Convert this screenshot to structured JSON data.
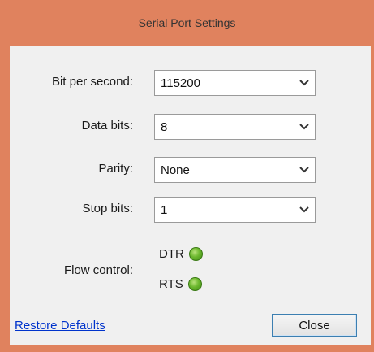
{
  "window": {
    "title": "Serial Port Settings"
  },
  "fields": [
    {
      "label": "Bit per second:",
      "value": "115200"
    },
    {
      "label": "Data bits:",
      "value": "8"
    },
    {
      "label": "Parity:",
      "value": "None"
    },
    {
      "label": "Stop bits:",
      "value": "1"
    }
  ],
  "flow_control": {
    "label": "Flow control:",
    "dtr": "DTR",
    "rts": "RTS",
    "led_color": "#6cb82e"
  },
  "footer": {
    "restore_label": "Restore Defaults",
    "close_label": "Close"
  },
  "colors": {
    "title_bar": "#e0825e",
    "link": "#0033cc"
  }
}
